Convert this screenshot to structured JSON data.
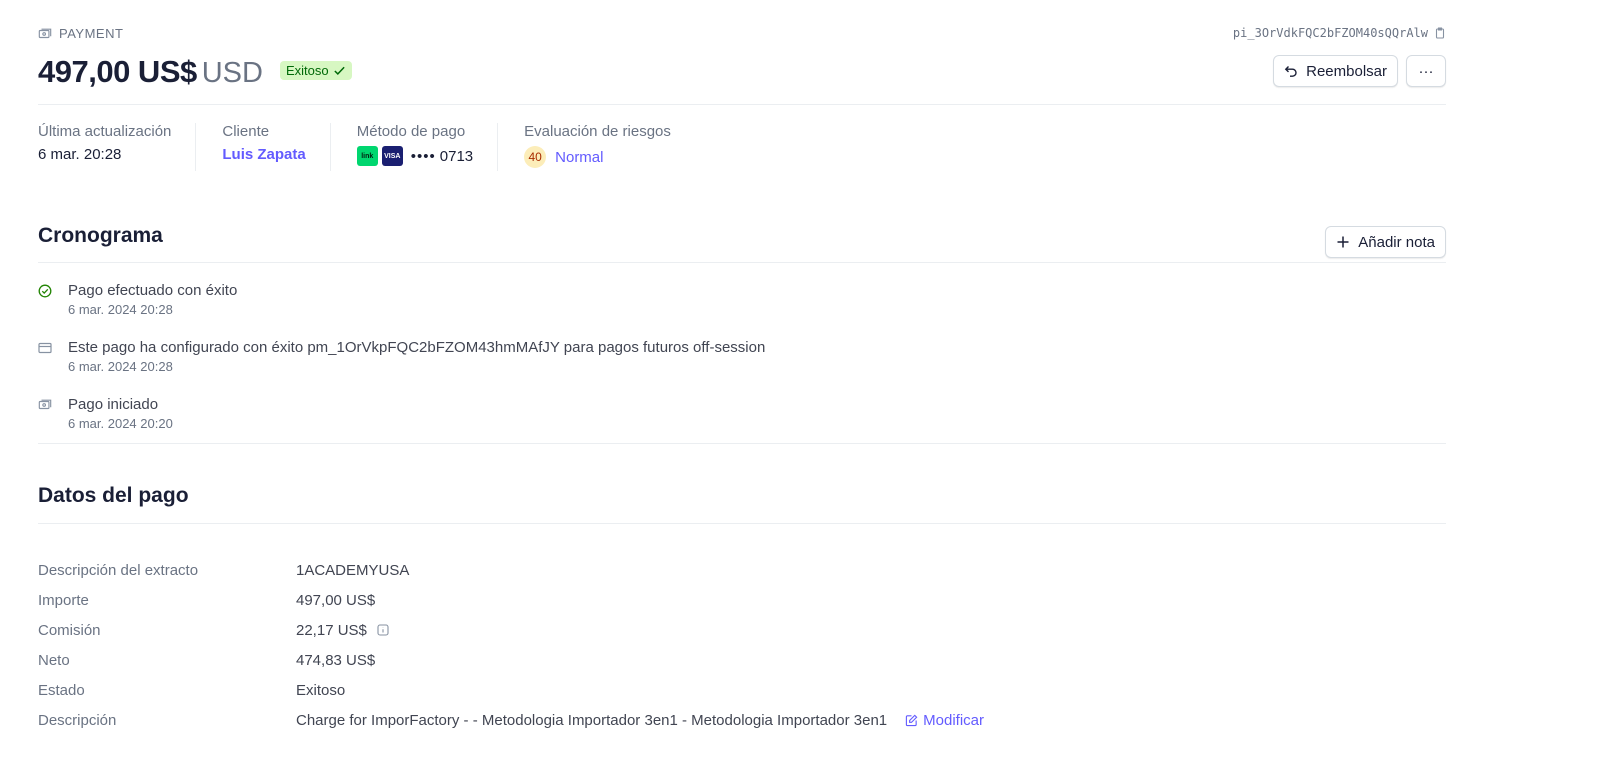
{
  "header": {
    "kind_label": "PAYMENT",
    "payment_id": "pi_3OrVdkFQC2bFZOM40sQQrAlw",
    "amount": "497,00 US$",
    "currency": "USD",
    "status": "Exitoso",
    "refund_label": "Reembolsar",
    "more_label": "···"
  },
  "summary": {
    "last_update_label": "Última actualización",
    "last_update_value": "6 mar. 20:28",
    "customer_label": "Cliente",
    "customer_value": "Luis Zapata",
    "payment_method_label": "Método de pago",
    "card_brand_link": "link",
    "card_brand_visa": "VISA",
    "card_dots": "••••",
    "card_last4": "0713",
    "risk_label": "Evaluación de riesgos",
    "risk_score": "40",
    "risk_level": "Normal"
  },
  "timeline": {
    "title": "Cronograma",
    "add_note_label": "Añadir nota",
    "events": [
      {
        "icon": "check-circle-icon",
        "title": "Pago efectuado con éxito",
        "time": "6 mar. 2024 20:28"
      },
      {
        "icon": "card-icon",
        "title": "Este pago ha configurado con éxito pm_1OrVkpFQC2bFZOM43hmMAfJY para pagos futuros off-session",
        "time": "6 mar. 2024 20:28"
      },
      {
        "icon": "payment-icon",
        "title": "Pago iniciado",
        "time": "6 mar. 2024 20:20"
      }
    ]
  },
  "details": {
    "title": "Datos del pago",
    "rows": [
      {
        "label": "Descripción del extracto",
        "value": "1ACADEMYUSA"
      },
      {
        "label": "Importe",
        "value": "497,00 US$"
      },
      {
        "label": "Comisión",
        "value": "22,17 US$"
      },
      {
        "label": "Neto",
        "value": "474,83 US$"
      },
      {
        "label": "Estado",
        "value": "Exitoso"
      },
      {
        "label": "Descripción",
        "value": "Charge for ImporFactory - - Metodologia Importador 3en1 - Metodologia Importador 3en1"
      }
    ],
    "modify_label": "Modificar"
  },
  "colors": {
    "accent": "#635bff",
    "success_bg": "#d7f7c2",
    "success_text": "#006908",
    "risk_bg": "#fcedb9"
  }
}
